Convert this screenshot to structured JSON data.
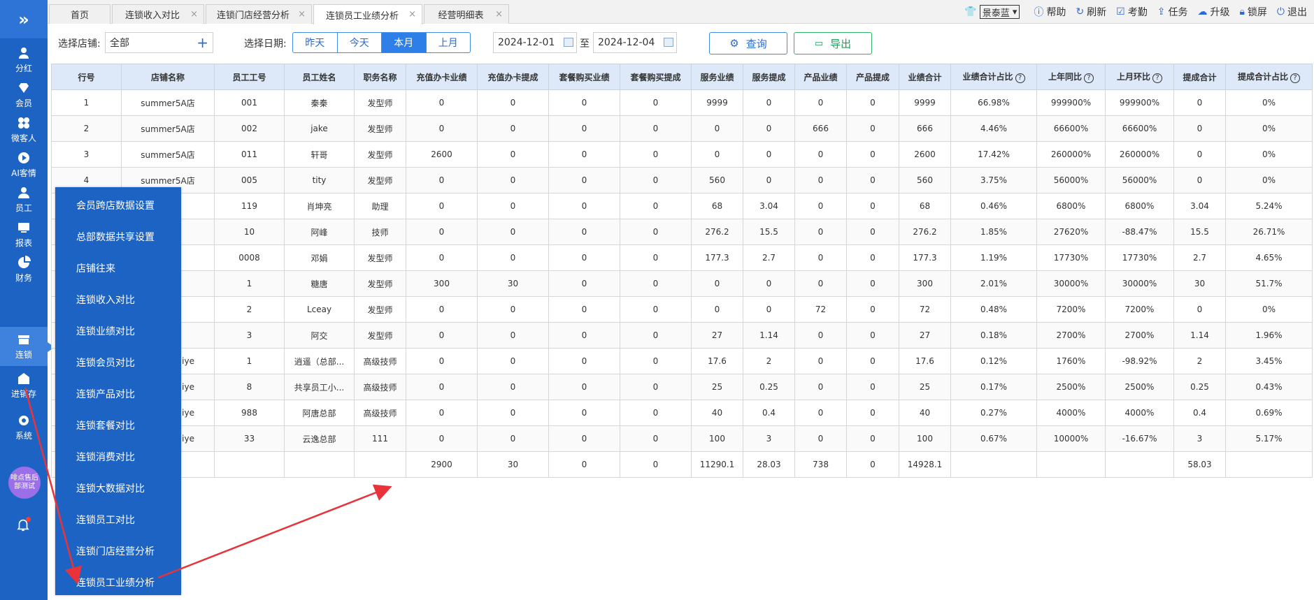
{
  "sidebar": {
    "expand_icon": "double-chevron-right-icon",
    "items": [
      {
        "label": "分红",
        "icon": "dividend-icon"
      },
      {
        "label": "会员",
        "icon": "diamond-icon"
      },
      {
        "label": "微客人",
        "icon": "clover-icon"
      },
      {
        "label": "AI客情",
        "icon": "play-circle-icon"
      },
      {
        "label": "员工",
        "icon": "person-icon"
      },
      {
        "label": "报表",
        "icon": "monitor-icon"
      },
      {
        "label": "财务",
        "icon": "pie-chart-icon"
      },
      {
        "label": "连锁",
        "icon": "store-icon"
      },
      {
        "label": "进销存",
        "icon": "warehouse-icon"
      },
      {
        "label": "系统",
        "icon": "gear-icon"
      }
    ],
    "avatar_text": "啡点售后部测试",
    "bell_icon": "bell-icon"
  },
  "tabs": [
    {
      "label": "首页",
      "closable": false
    },
    {
      "label": "连锁收入对比",
      "closable": true
    },
    {
      "label": "连锁门店经营分析",
      "closable": true
    },
    {
      "label": "连锁员工业绩分析",
      "closable": true,
      "active": true
    },
    {
      "label": "经营明细表",
      "closable": true
    }
  ],
  "toolbar": {
    "theme": "景泰蓝",
    "help": "帮助",
    "refresh": "刷新",
    "attendance": "考勤",
    "task": "任务",
    "upgrade": "升级",
    "lock": "锁屏",
    "logout": "退出"
  },
  "filters": {
    "store_label": "选择店铺:",
    "store_value": "全部",
    "date_label": "选择日期:",
    "date_buttons": [
      "昨天",
      "今天",
      "本月",
      "上月"
    ],
    "date_active": "本月",
    "start_date": "2024-12-01",
    "to": "至",
    "end_date": "2024-12-04",
    "query": "查询",
    "export": "导出"
  },
  "table": {
    "columns": [
      "行号",
      "店铺名称",
      "员工工号",
      "员工姓名",
      "职务名称",
      "充值办卡业绩",
      "充值办卡提成",
      "套餐购买业绩",
      "套餐购买提成",
      "服务业绩",
      "服务提成",
      "产品业绩",
      "产品提成",
      "业绩合计",
      "业绩合计占比",
      "上年同比",
      "上月环比",
      "提成合计",
      "提成合计占比"
    ],
    "help_columns": [
      14,
      15,
      16,
      18
    ],
    "rows": [
      [
        "1",
        "summer5A店",
        "001",
        "秦秦",
        "发型师",
        "0",
        "0",
        "0",
        "0",
        "9999",
        "0",
        "0",
        "0",
        "9999",
        "66.98%",
        "999900%",
        "999900%",
        "0",
        "0%"
      ],
      [
        "2",
        "summer5A店",
        "002",
        "jake",
        "发型师",
        "0",
        "0",
        "0",
        "0",
        "0",
        "0",
        "666",
        "0",
        "666",
        "4.46%",
        "66600%",
        "66600%",
        "0",
        "0%"
      ],
      [
        "3",
        "summer5A店",
        "011",
        "轩哥",
        "发型师",
        "2600",
        "0",
        "0",
        "0",
        "0",
        "0",
        "0",
        "0",
        "2600",
        "17.42%",
        "260000%",
        "260000%",
        "0",
        "0%"
      ],
      [
        "4",
        "summer5A店",
        "005",
        "tity",
        "发型师",
        "0",
        "0",
        "0",
        "0",
        "560",
        "0",
        "0",
        "0",
        "560",
        "3.75%",
        "56000%",
        "56000%",
        "0",
        "0%"
      ],
      [
        "",
        "",
        "119",
        "肖坤亮",
        "助理",
        "0",
        "0",
        "0",
        "0",
        "68",
        "3.04",
        "0",
        "0",
        "68",
        "0.46%",
        "6800%",
        "6800%",
        "3.04",
        "5.24%"
      ],
      [
        "",
        "",
        "10",
        "阿峰",
        "技师",
        "0",
        "0",
        "0",
        "0",
        "276.2",
        "15.5",
        "0",
        "0",
        "276.2",
        "1.85%",
        "27620%",
        "-88.47%",
        "15.5",
        "26.71%"
      ],
      [
        "",
        "",
        "0008",
        "邓娟",
        "发型师",
        "0",
        "0",
        "0",
        "0",
        "177.3",
        "2.7",
        "0",
        "0",
        "177.3",
        "1.19%",
        "17730%",
        "17730%",
        "2.7",
        "4.65%"
      ],
      [
        "",
        "",
        "1",
        "糖唐",
        "发型师",
        "300",
        "30",
        "0",
        "0",
        "0",
        "0",
        "0",
        "0",
        "300",
        "2.01%",
        "30000%",
        "30000%",
        "30",
        "51.7%"
      ],
      [
        "",
        "",
        "2",
        "Lceay",
        "发型师",
        "0",
        "0",
        "0",
        "0",
        "0",
        "0",
        "72",
        "0",
        "72",
        "0.48%",
        "7200%",
        "7200%",
        "0",
        "0%"
      ],
      [
        "",
        "",
        "3",
        "阿交",
        "发型师",
        "0",
        "0",
        "0",
        "0",
        "27",
        "1.14",
        "0",
        "0",
        "27",
        "0.18%",
        "2700%",
        "2700%",
        "1.14",
        "1.96%"
      ],
      [
        "",
        "iye",
        "1",
        "逍遥（总部...",
        "高级技师",
        "0",
        "0",
        "0",
        "0",
        "17.6",
        "2",
        "0",
        "0",
        "17.6",
        "0.12%",
        "1760%",
        "-98.92%",
        "2",
        "3.45%"
      ],
      [
        "",
        "iye",
        "8",
        "共享员工小...",
        "高级技师",
        "0",
        "0",
        "0",
        "0",
        "25",
        "0.25",
        "0",
        "0",
        "25",
        "0.17%",
        "2500%",
        "2500%",
        "0.25",
        "0.43%"
      ],
      [
        "",
        "iye",
        "988",
        "阿唐总部",
        "高级技师",
        "0",
        "0",
        "0",
        "0",
        "40",
        "0.4",
        "0",
        "0",
        "40",
        "0.27%",
        "4000%",
        "4000%",
        "0.4",
        "0.69%"
      ],
      [
        "",
        "iye",
        "33",
        "云逸总部",
        "111",
        "0",
        "0",
        "0",
        "0",
        "100",
        "3",
        "0",
        "0",
        "100",
        "0.67%",
        "10000%",
        "-16.67%",
        "3",
        "5.17%"
      ],
      [
        "",
        "",
        "",
        "",
        "",
        "2900",
        "30",
        "0",
        "0",
        "11290.1",
        "28.03",
        "738",
        "0",
        "14928.1",
        "",
        "",
        "",
        "58.03",
        ""
      ]
    ]
  },
  "menu": {
    "items": [
      "会员跨店数据设置",
      "总部数据共享设置",
      "店铺往来",
      "连锁收入对比",
      "连锁业绩对比",
      "连锁会员对比",
      "连锁产品对比",
      "连锁套餐对比",
      "连锁消费对比",
      "连锁大数据对比",
      "连锁员工对比",
      "连锁门店经营分析",
      "连锁员工业绩分析"
    ]
  },
  "colors": {
    "sidebar": "#1d63c4",
    "accent": "#2f7fe8",
    "export": "#2fb36b",
    "arrow": "#e8333a"
  }
}
